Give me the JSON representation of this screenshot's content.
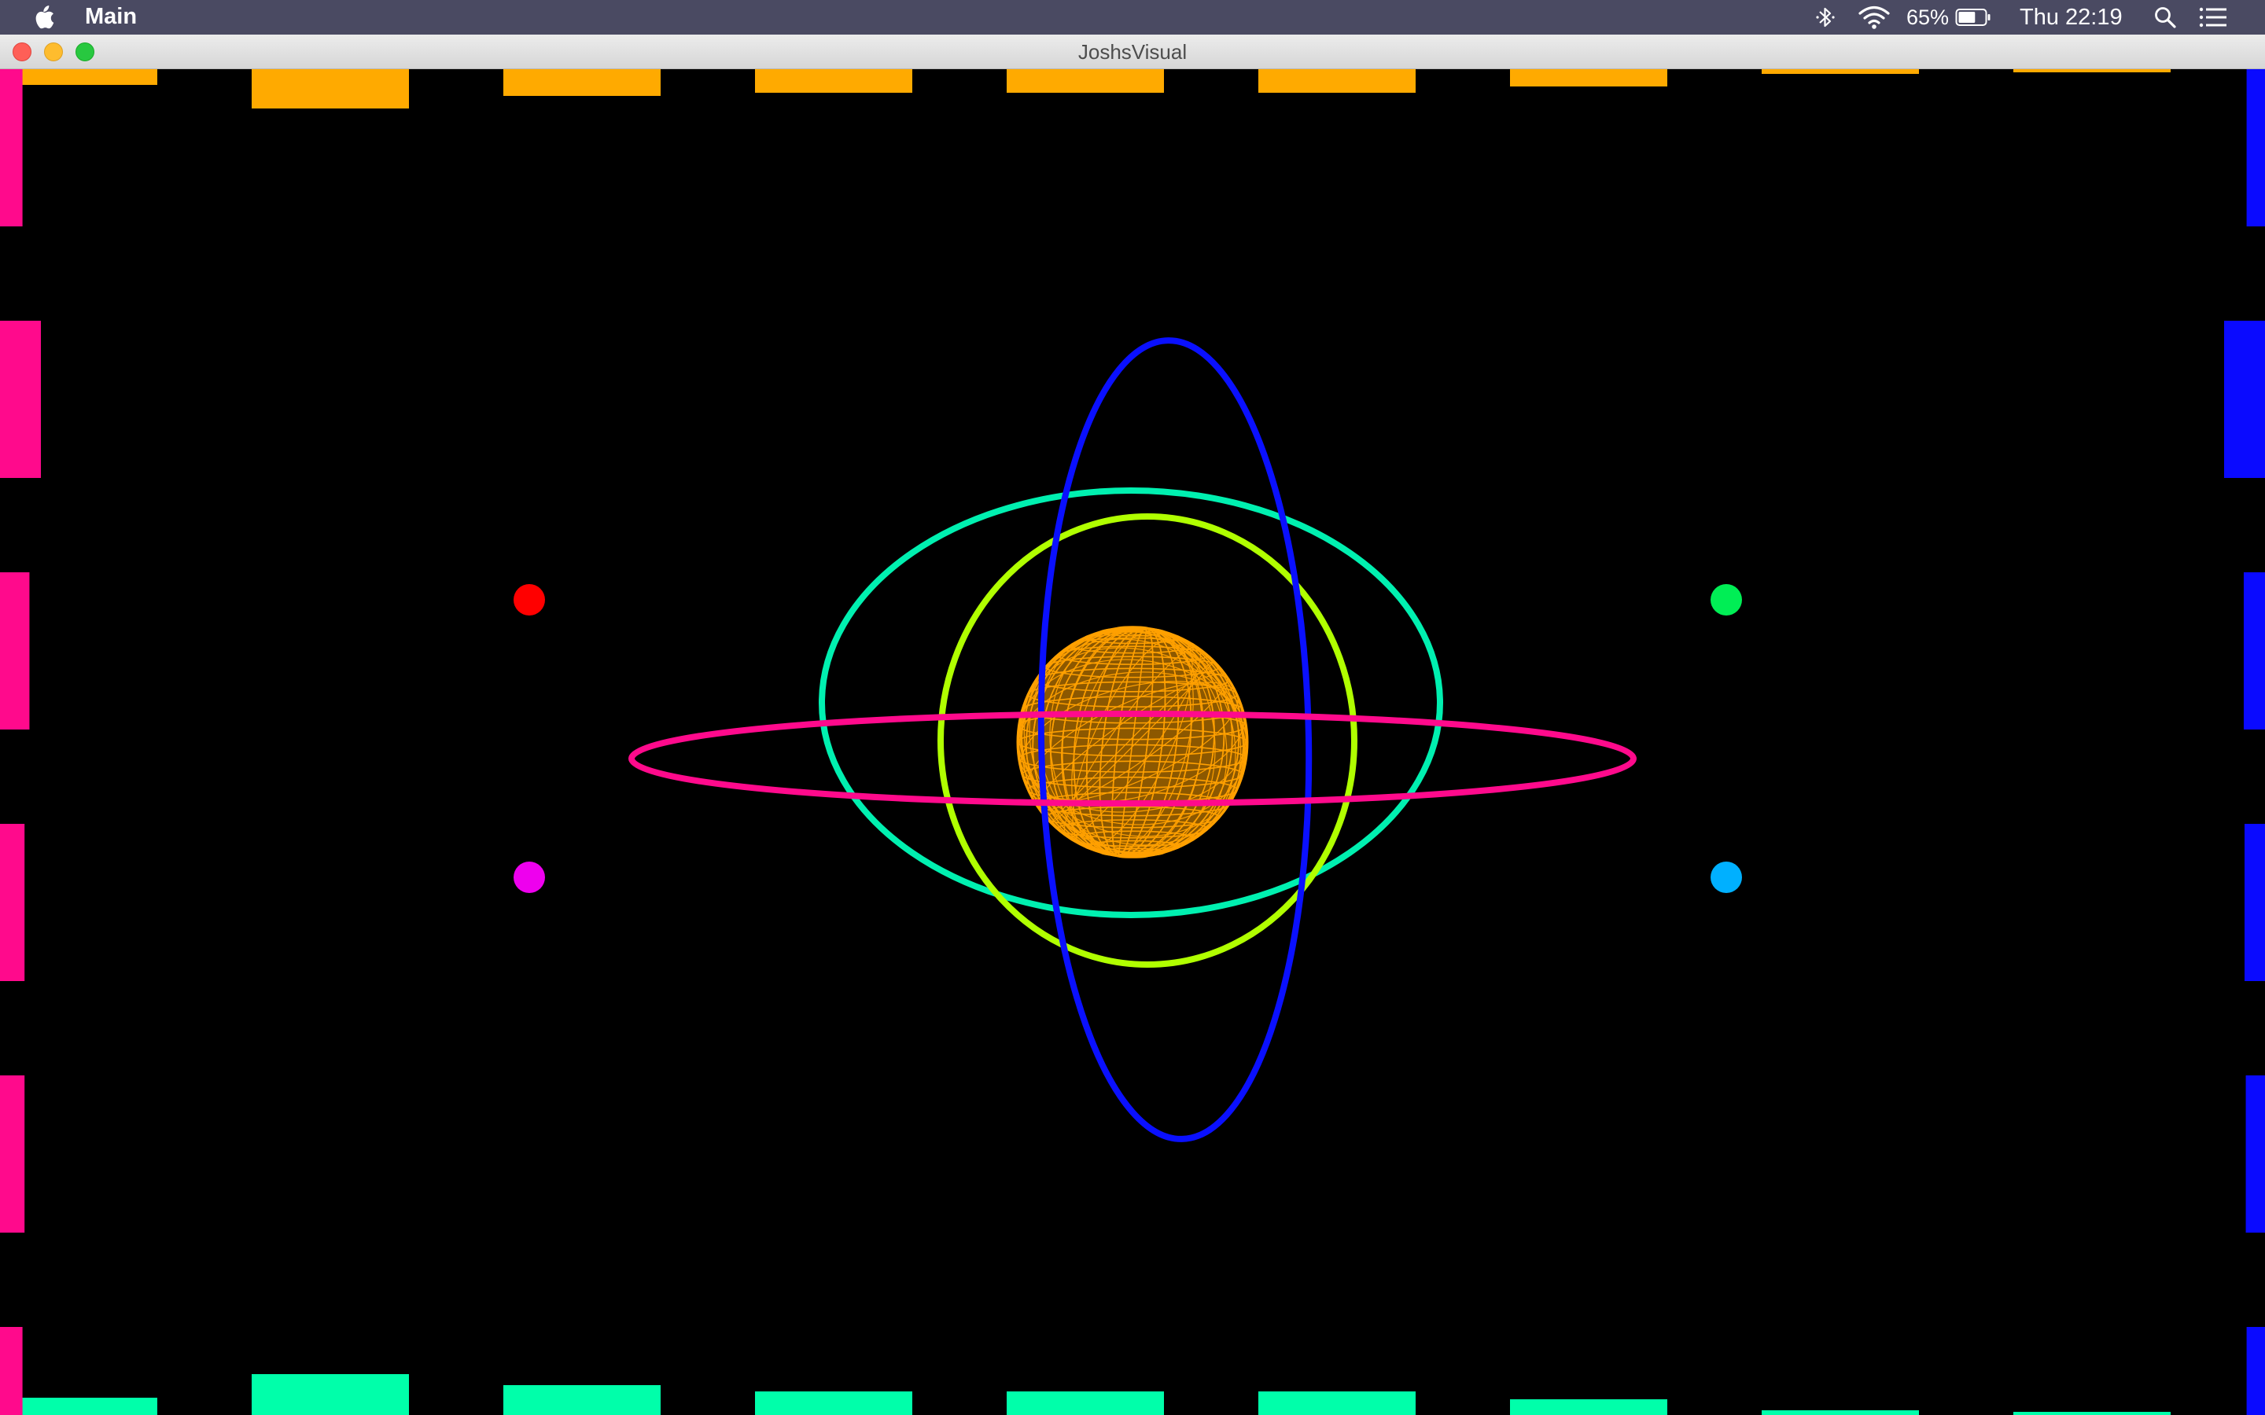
{
  "menubar": {
    "app_name": "Main",
    "battery": "65%",
    "clock": "Thu 22:19",
    "icons": [
      "apple-icon",
      "bluetooth-icon",
      "wifi-icon",
      "battery-icon",
      "spotlight-search-icon",
      "notification-center-icon"
    ]
  },
  "window": {
    "title": "JoshsVisual"
  },
  "visual": {
    "colors": {
      "top_bars": "#ffaa00",
      "bottom_bars": "#00ffaa",
      "left_bars": "#ff0a8c",
      "right_bars": "#0a0aff",
      "sphere": "#ffa000",
      "ring_pink": "#ff0a8c",
      "ring_blue": "#0a10ff",
      "ring_teal": "#00f0b0",
      "ring_lime": "#b0ff00",
      "dot_red": "#ff0000",
      "dot_green": "#00ee55",
      "dot_magenta": "#ee00ee",
      "dot_cyan": "#00b0ff"
    },
    "top_bar_levels": [
      0.1,
      0.25,
      0.17,
      0.15,
      0.15,
      0.15,
      0.11,
      0.03,
      0.02
    ],
    "bottom_bar_levels": [
      0.11,
      0.26,
      0.19,
      0.15,
      0.15,
      0.15,
      0.1,
      0.03,
      0.02
    ],
    "left_bar_levels": [
      0.55,
      1.0,
      0.72,
      0.6,
      0.6,
      0.55
    ],
    "right_bar_levels": [
      0.45,
      1.0,
      0.52,
      0.5,
      0.47,
      0.45
    ]
  }
}
